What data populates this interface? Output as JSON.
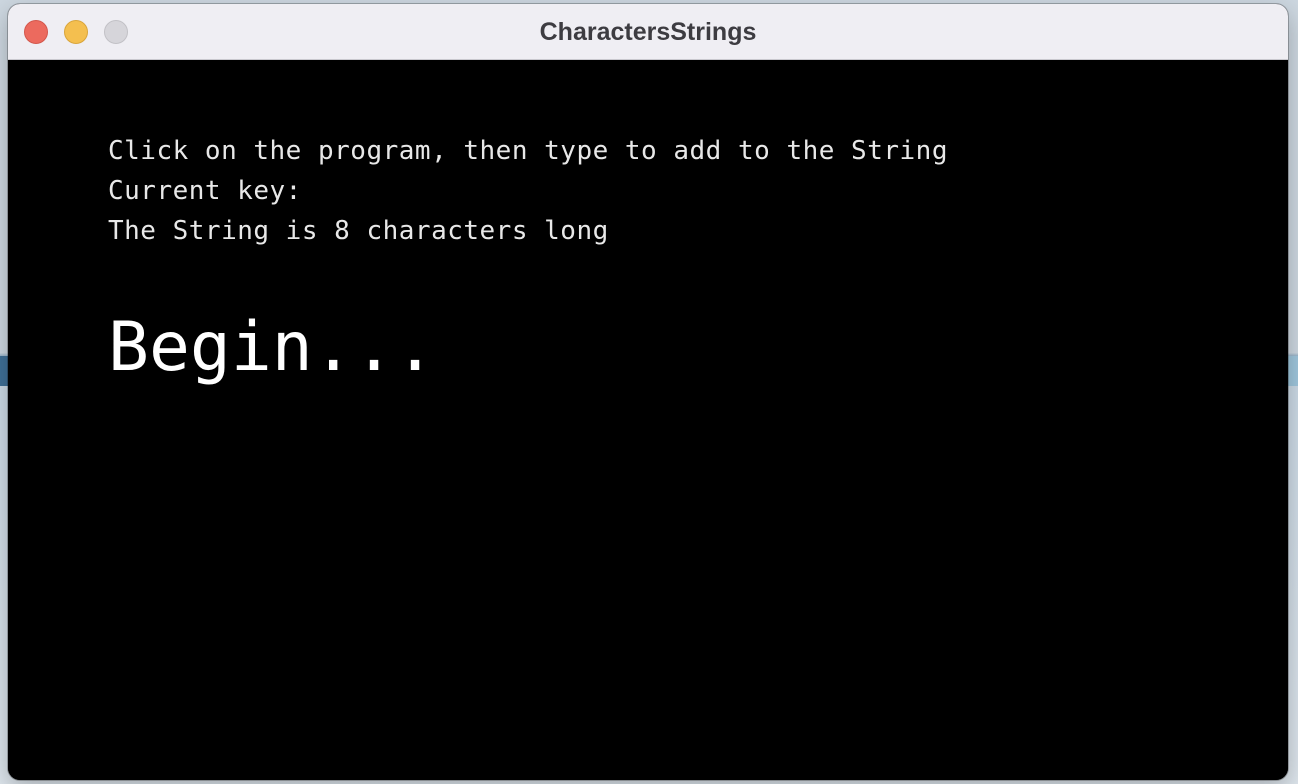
{
  "window": {
    "title": "CharactersStrings",
    "controls": {
      "close": "close",
      "minimize": "minimize",
      "zoom": "zoom"
    },
    "colors": {
      "close": "#ec6a5e",
      "minimize": "#f4bf4f",
      "zoom": "#d6d5da",
      "titlebar": "#efeef3",
      "canvas": "#000000"
    }
  },
  "sketch": {
    "instruction": "Click on the program, then type to add to the String",
    "current_key": "Current key:",
    "length_text": "The String is 8 characters long",
    "string_value": "Begin..."
  }
}
